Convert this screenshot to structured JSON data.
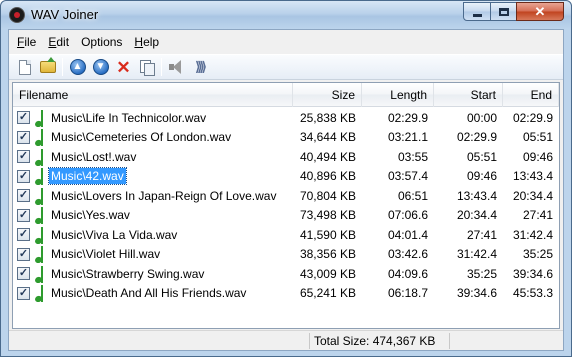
{
  "window": {
    "title": "WAV Joiner"
  },
  "menu": [
    {
      "key": "File",
      "label": "ile",
      "accel": "F"
    },
    {
      "key": "Edit",
      "label": "dit",
      "accel": "E"
    },
    {
      "key": "Options",
      "label": "Options",
      "accel": ""
    },
    {
      "key": "Help",
      "label": "elp",
      "accel": "H"
    }
  ],
  "menu_labels": {
    "file": "File",
    "edit": "Edit",
    "options": "Options",
    "help": "Help"
  },
  "toolbar": {
    "buttons": [
      "new-file-icon",
      "open-folder-icon",
      "move-up-icon",
      "move-down-icon",
      "delete-icon",
      "copy-icon",
      "play-icon",
      "join-icon"
    ]
  },
  "columns": {
    "filename": "Filename",
    "size": "Size",
    "length": "Length",
    "start": "Start",
    "end": "End"
  },
  "files": [
    {
      "name": "Music\\Life In Technicolor.wav",
      "size": "25,838 KB",
      "length": "02:29.9",
      "start": "00:00",
      "end": "02:29.9",
      "checked": true
    },
    {
      "name": "Music\\Cemeteries Of London.wav",
      "size": "34,644 KB",
      "length": "03:21.1",
      "start": "02:29.9",
      "end": "05:51",
      "checked": true
    },
    {
      "name": "Music\\Lost!.wav",
      "size": "40,494 KB",
      "length": "03:55",
      "start": "05:51",
      "end": "09:46",
      "checked": true
    },
    {
      "name": "Music\\42.wav",
      "size": "40,896 KB",
      "length": "03:57.4",
      "start": "09:46",
      "end": "13:43.4",
      "checked": true,
      "selected": true
    },
    {
      "name": "Music\\Lovers In Japan-Reign Of Love.wav",
      "size": "70,804 KB",
      "length": "06:51",
      "start": "13:43.4",
      "end": "20:34.4",
      "checked": true
    },
    {
      "name": "Music\\Yes.wav",
      "size": "73,498 KB",
      "length": "07:06.6",
      "start": "20:34.4",
      "end": "27:41",
      "checked": true
    },
    {
      "name": "Music\\Viva La Vida.wav",
      "size": "41,590 KB",
      "length": "04:01.4",
      "start": "27:41",
      "end": "31:42.4",
      "checked": true
    },
    {
      "name": "Music\\Violet Hill.wav",
      "size": "38,356 KB",
      "length": "03:42.6",
      "start": "31:42.4",
      "end": "35:25",
      "checked": true
    },
    {
      "name": "Music\\Strawberry Swing.wav",
      "size": "43,009 KB",
      "length": "04:09.6",
      "start": "35:25",
      "end": "39:34.6",
      "checked": true
    },
    {
      "name": "Music\\Death And All His Friends.wav",
      "size": "65,241 KB",
      "length": "06:18.7",
      "start": "39:34.6",
      "end": "45:53.3",
      "checked": true
    }
  ],
  "status": {
    "total_size": "Total Size: 474,367 KB"
  },
  "colors": {
    "selection": "#3399ff",
    "note": "#2e9b2e",
    "close_button": "#c0431f"
  }
}
